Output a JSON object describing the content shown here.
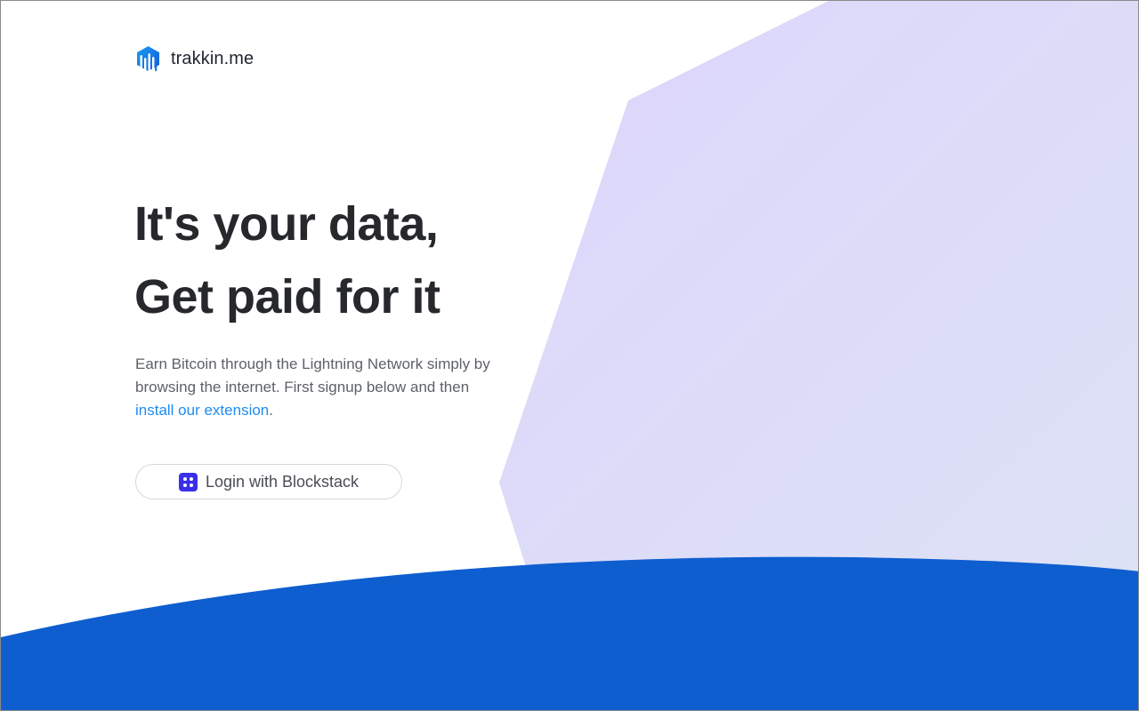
{
  "brand": {
    "name": "trakkin.me",
    "logo_icon": "trakkin-logo-icon"
  },
  "hero": {
    "headline_line1": "It's your data,",
    "headline_line2": "Get paid for it",
    "lead_text": "Earn Bitcoin through the Lightning Network simply by browsing the internet. First signup below and then ",
    "lead_link": "install our extension",
    "lead_end": "."
  },
  "login": {
    "label": "Login with Blockstack",
    "icon": "blockstack-icon"
  },
  "colors": {
    "accent_blue": "#0e5ecf",
    "link_blue": "#1d8cf0",
    "lavender": "#dcd8fb",
    "blockstack_purple": "#3b30e8",
    "heading": "#26282c"
  }
}
